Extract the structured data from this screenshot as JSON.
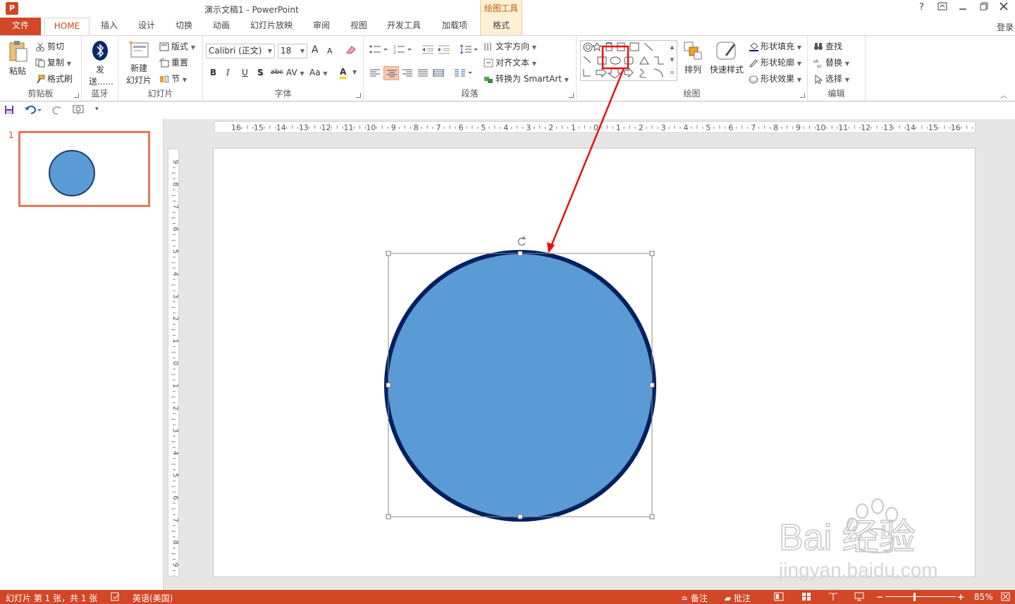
{
  "app": {
    "title": "演示文稿1 - PowerPoint",
    "context_tool": "绘图工具",
    "login": "登录",
    "help": "?",
    "app_icon_letter": "P"
  },
  "tabs": [
    {
      "label": "文件"
    },
    {
      "label": "HOME"
    },
    {
      "label": "插入"
    },
    {
      "label": "设计"
    },
    {
      "label": "切换"
    },
    {
      "label": "动画"
    },
    {
      "label": "幻灯片放映"
    },
    {
      "label": "审阅"
    },
    {
      "label": "视图"
    },
    {
      "label": "开发工具"
    },
    {
      "label": "加载项"
    },
    {
      "label": "格式"
    }
  ],
  "ribbon": {
    "clipboard": {
      "label": "剪贴板",
      "paste": "粘贴",
      "cut": "剪切",
      "copy": "复制",
      "format_painter": "格式刷"
    },
    "bluetooth": {
      "label": "蓝牙",
      "send_line1": "发",
      "send_line2": "送......"
    },
    "slides": {
      "label": "幻灯片",
      "new_slide_line1": "新建",
      "new_slide_line2": "幻灯片",
      "layout": "版式",
      "reset": "重置",
      "section": "节"
    },
    "font": {
      "label": "字体",
      "font_name": "Calibri (正文)",
      "font_size": "18",
      "grow": "A",
      "shrink": "A",
      "bold": "B",
      "italic": "I",
      "underline": "U",
      "shadow": "S",
      "strike": "abc",
      "spacing": "AV",
      "case": "Aa",
      "color": "A"
    },
    "paragraph": {
      "label": "段落",
      "text_direction": "文字方向",
      "align_text": "对齐文本",
      "smartart": "转换为 SmartArt"
    },
    "drawing": {
      "label": "绘图",
      "arrange": "排列",
      "quick_styles": "快速样式",
      "fill": "形状填充",
      "outline": "形状轮廓",
      "effects": "形状效果"
    },
    "editing": {
      "label": "编辑",
      "find": "查找",
      "replace": "替换",
      "select": "选择"
    }
  },
  "slides_pane": {
    "slide_number": "1"
  },
  "status": {
    "slide_info": "幻灯片 第 1 张，共 1 张",
    "language": "英语(美国)",
    "notes": "备注",
    "comments": "批注",
    "zoom": "85%"
  },
  "ruler": {
    "h_ticks": [
      "16",
      "15",
      "14",
      "13",
      "12",
      "11",
      "10",
      "9",
      "8",
      "7",
      "6",
      "5",
      "4",
      "3",
      "2",
      "1",
      "0",
      "1",
      "2",
      "3",
      "4",
      "5",
      "6",
      "7",
      "8",
      "9",
      "10",
      "11",
      "12",
      "13",
      "14",
      "15",
      "16"
    ],
    "v_ticks": [
      "9",
      "8",
      "7",
      "6",
      "5",
      "4",
      "3",
      "2",
      "1",
      "0",
      "1",
      "2",
      "3",
      "4",
      "5",
      "6",
      "7",
      "8",
      "9"
    ]
  },
  "watermark": {
    "brand": "Bai  经验",
    "url": "jingyan.baidu.com"
  },
  "colors": {
    "accent": "#d24726",
    "circle_fill": "#5b9bd5",
    "circle_outline": "#002060",
    "highlight": "#e81010"
  }
}
